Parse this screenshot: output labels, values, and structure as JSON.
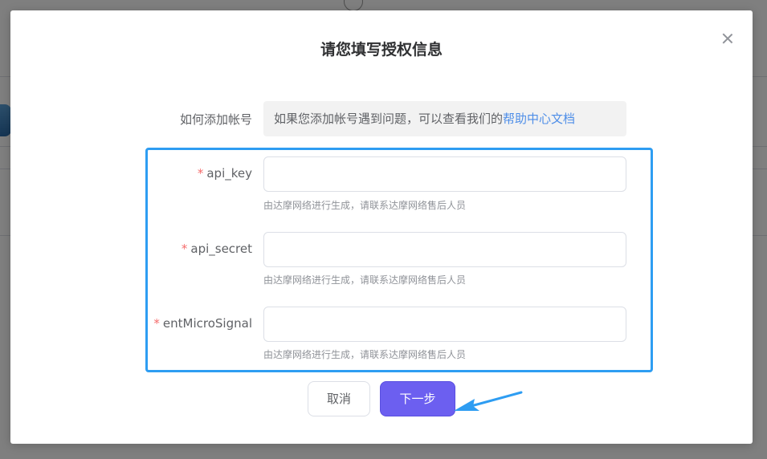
{
  "dialog": {
    "title": "请您填写授权信息",
    "how_to_add": {
      "label": "如何添加帐号",
      "text": "如果您添加帐号遇到问题，可以查看我们的",
      "link_text": "帮助中心文档"
    },
    "fields": [
      {
        "label": "api_key",
        "value": "",
        "hint": "由达摩网络进行生成，请联系达摩网络售后人员"
      },
      {
        "label": "api_secret",
        "value": "",
        "hint": "由达摩网络进行生成，请联系达摩网络售后人员"
      },
      {
        "label": "entMicroSignal",
        "value": "",
        "hint": "由达摩网络进行生成，请联系达摩网络售后人员"
      }
    ],
    "required_mark": "*",
    "cancel_label": "取消",
    "next_label": "下一步"
  },
  "colors": {
    "primary_button": "#6c5ff0",
    "highlight_border": "#2e9df2",
    "link": "#4e8ee8",
    "required": "#f56c6c"
  },
  "icons": {
    "close": "close-icon",
    "annotation": "arrow-annotation-icon"
  }
}
